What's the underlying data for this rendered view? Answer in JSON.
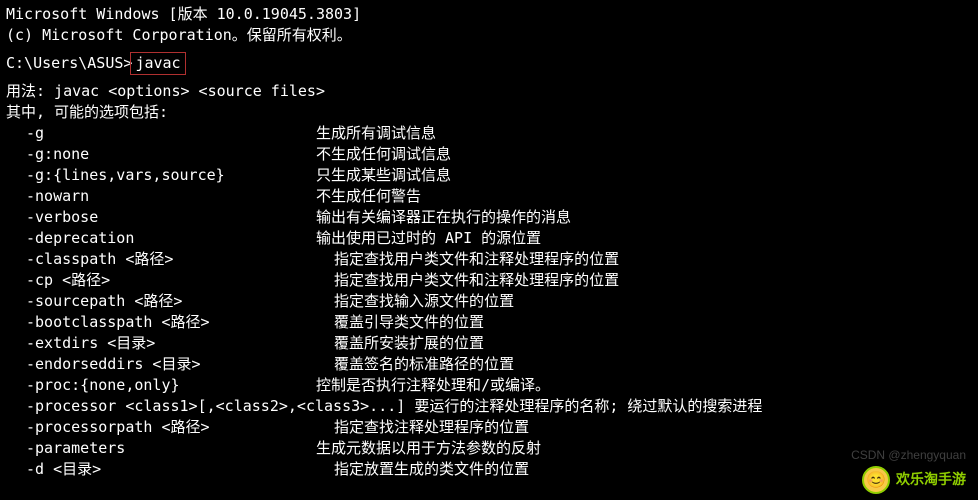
{
  "header": {
    "version_line": "Microsoft Windows [版本 10.0.19045.3803]",
    "copyright": "(c) Microsoft Corporation。保留所有权利。"
  },
  "prompt": {
    "path": "C:\\Users\\ASUS>",
    "command": "javac"
  },
  "usage": {
    "label": "用法: javac <options> <source files>",
    "options_heading": "其中, 可能的选项包括:"
  },
  "options": [
    {
      "flag": "-g",
      "desc": "生成所有调试信息"
    },
    {
      "flag": "-g:none",
      "desc": "不生成任何调试信息"
    },
    {
      "flag": "-g:{lines,vars,source}",
      "desc": "只生成某些调试信息"
    },
    {
      "flag": "-nowarn",
      "desc": "不生成任何警告"
    },
    {
      "flag": "-verbose",
      "desc": "输出有关编译器正在执行的操作的消息"
    },
    {
      "flag": "-deprecation",
      "desc": "输出使用已过时的 API 的源位置"
    },
    {
      "flag": "-classpath <路径>",
      "desc": "  指定查找用户类文件和注释处理程序的位置"
    },
    {
      "flag": "-cp <路径>",
      "desc": "  指定查找用户类文件和注释处理程序的位置"
    },
    {
      "flag": "-sourcepath <路径>",
      "desc": "  指定查找输入源文件的位置"
    },
    {
      "flag": "-bootclasspath <路径>",
      "desc": "  覆盖引导类文件的位置"
    },
    {
      "flag": "-extdirs <目录>",
      "desc": "  覆盖所安装扩展的位置"
    },
    {
      "flag": "-endorseddirs <目录>",
      "desc": "  覆盖签名的标准路径的位置"
    },
    {
      "flag": "-proc:{none,only}",
      "desc": "控制是否执行注释处理和/或编译。"
    },
    {
      "flag": "-processor <class1>[,<class2>,<class3>...] 要运行的注释处理程序的名称; 绕过默认的搜索进程",
      "desc": ""
    },
    {
      "flag": "-processorpath <路径>",
      "desc": "  指定查找注释处理程序的位置"
    },
    {
      "flag": "-parameters",
      "desc": "生成元数据以用于方法参数的反射"
    },
    {
      "flag": "-d <目录>",
      "desc": "  指定放置生成的类文件的位置"
    }
  ],
  "watermark": {
    "csdn": "CSDN @zhengyquan",
    "brand": "欢乐淘手游"
  }
}
